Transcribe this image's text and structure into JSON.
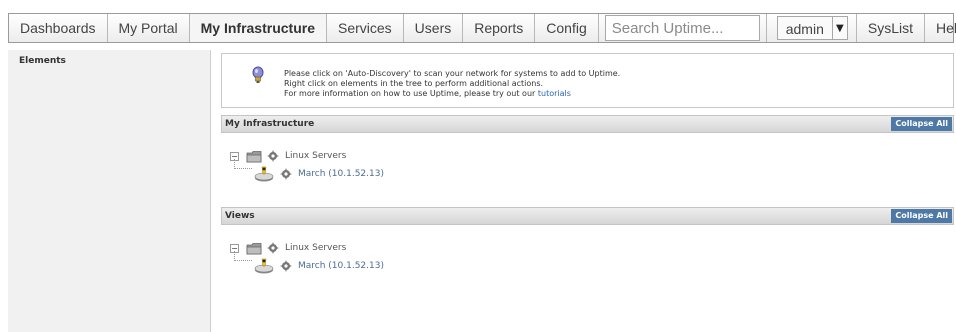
{
  "nav": {
    "tabs": [
      {
        "label": "Dashboards"
      },
      {
        "label": "My Portal"
      },
      {
        "label": "My Infrastructure"
      },
      {
        "label": "Services"
      },
      {
        "label": "Users"
      },
      {
        "label": "Reports"
      },
      {
        "label": "Config"
      }
    ],
    "search_placeholder": "Search Uptime...",
    "user_label": "admin",
    "syslist_label": "SysList",
    "help_label": "Help"
  },
  "left_panel": {
    "title": "Elements"
  },
  "info": {
    "line1": "Please click on 'Auto-Discovery' to scan your network for systems to add to Uptime.",
    "line2": "Right click on elements in the tree to perform additional actions.",
    "line3_prefix": "For more information on how to use Uptime, please try out our",
    "link": "tutorials"
  },
  "sections": {
    "infrastructure": {
      "title": "My Infrastructure",
      "collapse_label": "Collapse All",
      "group_label": "Linux Servers",
      "host_label": "March (10.1.52.13)"
    },
    "views": {
      "title": "Views",
      "collapse_label": "Collapse All",
      "group_label": "Linux Servers",
      "host_label": "March (10.1.52.13)"
    }
  },
  "colors": {
    "accent_button": "#4e79a7",
    "link": "#2a64b8",
    "header_bg": "#dcdcdc"
  }
}
